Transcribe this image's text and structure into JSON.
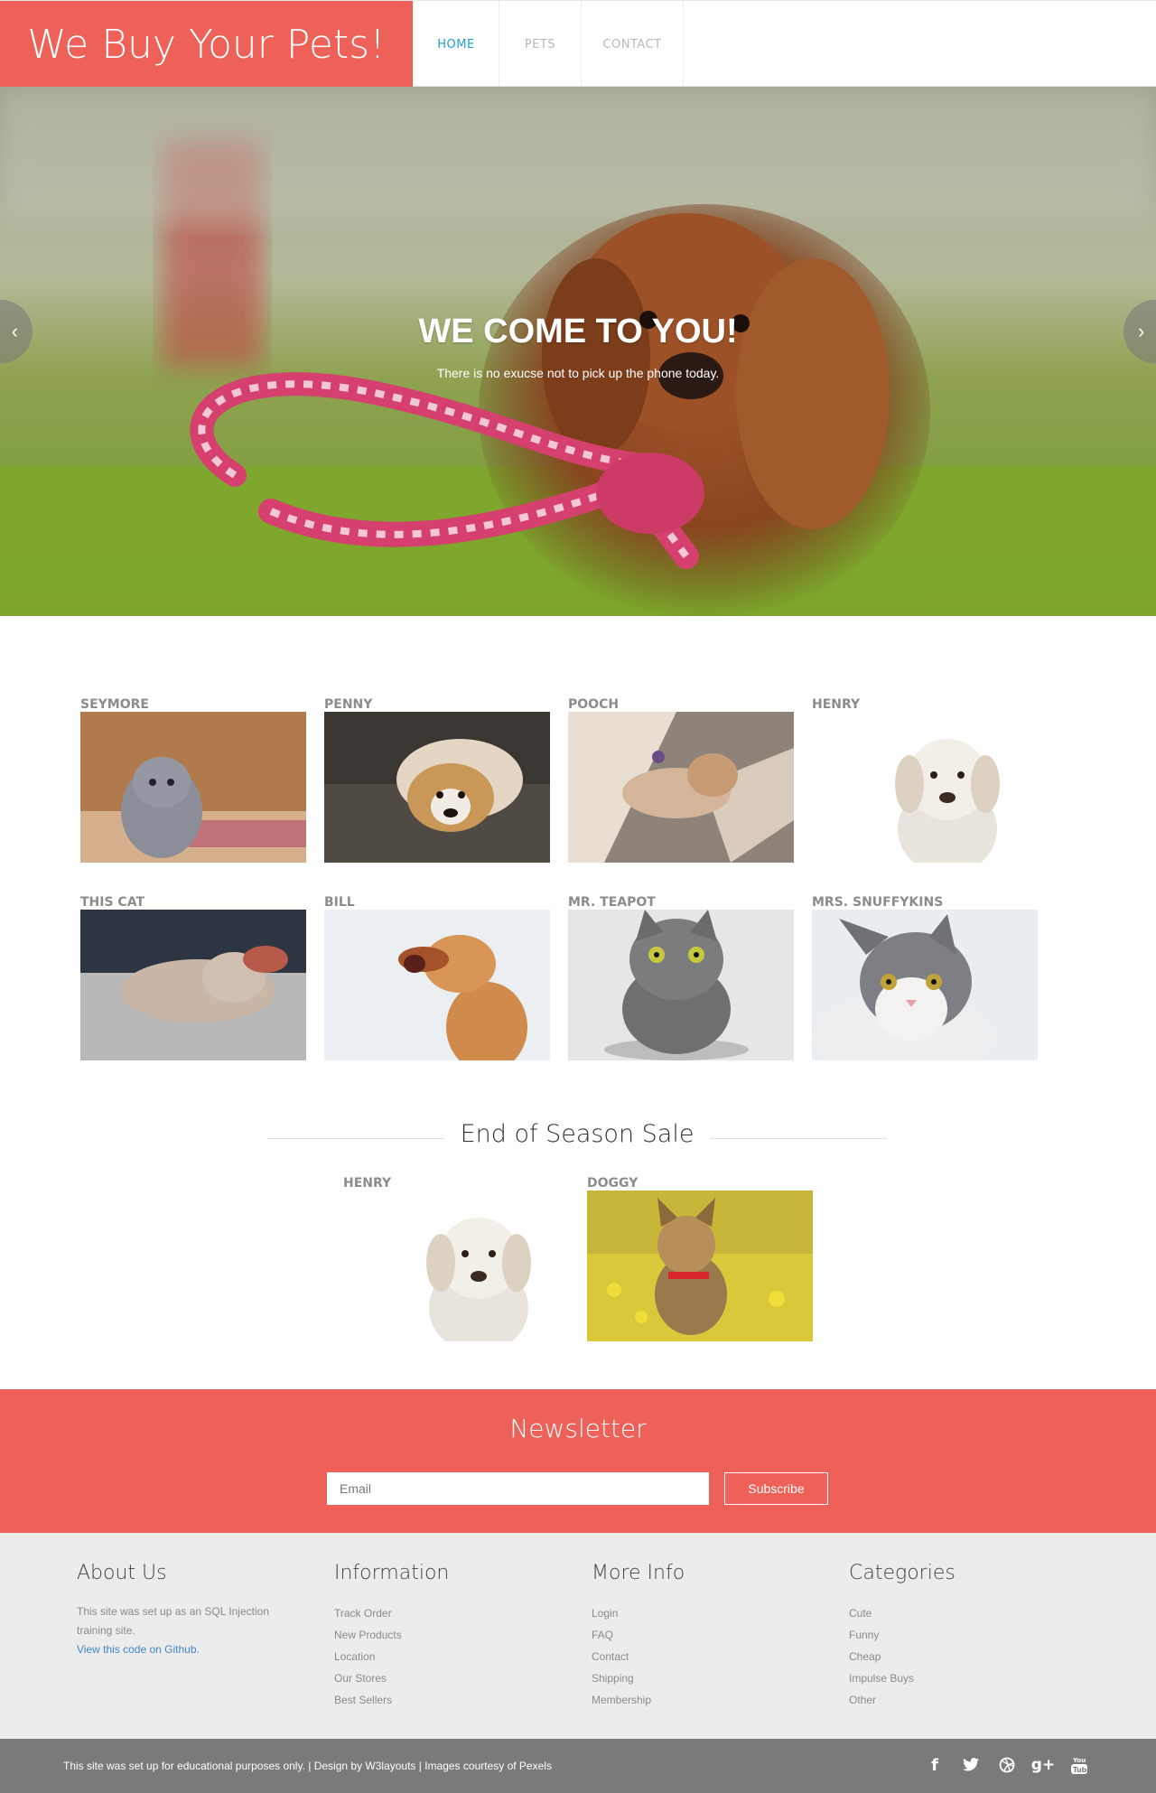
{
  "brand": {
    "title": "We Buy Your Pets!",
    "color": "#ee6158"
  },
  "nav": {
    "items": [
      {
        "label": "HOME",
        "active": true
      },
      {
        "label": "PETS",
        "active": false
      },
      {
        "label": "CONTACT",
        "active": false
      }
    ]
  },
  "hero": {
    "title": "WE COME TO YOU!",
    "subtitle": "There is no exucse not to pick up the phone today.",
    "prev_icon": "chevron-left-icon",
    "next_icon": "chevron-right-icon"
  },
  "pets": [
    {
      "name": "SEYMORE",
      "image": "grey kitten"
    },
    {
      "name": "PENNY",
      "image": "dog on couch"
    },
    {
      "name": "POOCH",
      "image": "sleeping kitten in sun"
    },
    {
      "name": "HENRY",
      "image": "white puppy"
    },
    {
      "name": "THIS CAT",
      "image": "cat sleeping on blanket"
    },
    {
      "name": "BILL",
      "image": "yawning golden dog"
    },
    {
      "name": "MR. TEAPOT",
      "image": "grey cat"
    },
    {
      "name": "MRS. SNUFFYKINS",
      "image": "grey and white cat"
    }
  ],
  "sale": {
    "title": "End of Season Sale",
    "items": [
      {
        "name": "HENRY",
        "image": "white puppy"
      },
      {
        "name": "DOGGY",
        "image": "terrier in flowers"
      }
    ]
  },
  "newsletter": {
    "title": "Newsletter",
    "email_placeholder": "Email",
    "subscribe_label": "Subscribe"
  },
  "footer": {
    "about": {
      "title": "About Us",
      "text": "This site was set up as an SQL Injection training site.",
      "link": "View this code on Github."
    },
    "information": {
      "title": "Information",
      "items": [
        "Track Order",
        "New Products",
        "Location",
        "Our Stores",
        "Best Sellers"
      ]
    },
    "more_info": {
      "title": "More Info",
      "items": [
        "Login",
        "FAQ",
        "Contact",
        "Shipping",
        "Membership"
      ]
    },
    "categories": {
      "title": "Categories",
      "items": [
        "Cute",
        "Funny",
        "Cheap",
        "Impulse Buys",
        "Other"
      ]
    }
  },
  "bottom": {
    "copyright": "This site was set up for educational purposes only. | Design by W3layouts | Images courtesy of Pexels",
    "social": [
      {
        "icon": "facebook-icon",
        "glyph": "f"
      },
      {
        "icon": "twitter-icon",
        "glyph": "🐦"
      },
      {
        "icon": "dribbble-icon",
        "glyph": "⚽"
      },
      {
        "icon": "google-plus-icon",
        "glyph": "g+"
      },
      {
        "icon": "youtube-icon",
        "glyph": "▶"
      }
    ]
  }
}
